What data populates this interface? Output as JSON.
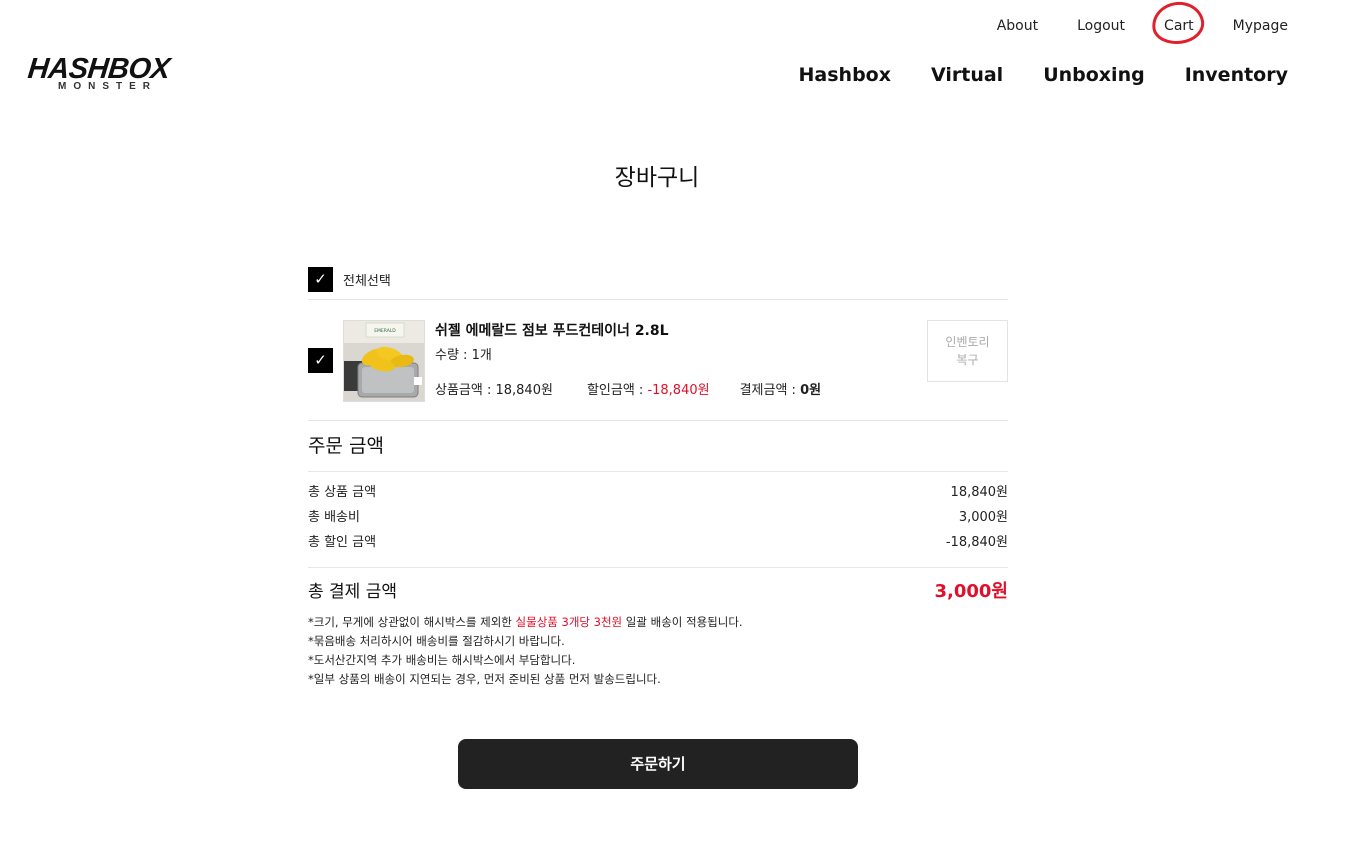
{
  "logo": {
    "main": "HASHBOX",
    "sub": "MONSTER"
  },
  "top_links": [
    "About",
    "Logout",
    "Cart",
    "Mypage"
  ],
  "main_nav": [
    "Hashbox",
    "Virtual",
    "Unboxing",
    "Inventory"
  ],
  "page_title": "장바구니",
  "select_all": {
    "checked": true,
    "label": "전체선택"
  },
  "cart_item": {
    "checked": true,
    "name": "쉬젤 에메랄드 점보 푸드컨테이너 2.8L",
    "quantity": "수량 : 1개",
    "product_price_label": "상품금액 : 18,840원",
    "discount_label": "할인금액 : ",
    "discount_value": "-18,840원",
    "payment_label": "결제금액 : ",
    "payment_value": "0원",
    "restore_button": [
      "인벤토리",
      "복구"
    ],
    "thumb_brand": "EMERALD"
  },
  "summary": {
    "title": "주문 금액",
    "rows": [
      {
        "label": "총 상품 금액",
        "value": "18,840원"
      },
      {
        "label": "총 배송비",
        "value": "3,000원"
      },
      {
        "label": "총 할인 금액",
        "value": "-18,840원"
      }
    ],
    "total_label": "총 결제 금액",
    "total_value": "3,000원"
  },
  "notes": {
    "line1_prefix": "*크기, 무게에 상관없이 해시박스를 제외한 ",
    "line1_highlight": "실물상품 3개당 3천원",
    "line1_suffix": " 일괄 배송이 적용됩니다.",
    "line2": "*묶음배송 처리하시어 배송비를 절감하시기 바랍니다.",
    "line3": "*도서산간지역 추가 배송비는 해시박스에서 부담합니다.",
    "line4": "*일부 상품의 배송이 지연되는 경우, 먼저 준비된 상품 먼저 발송드립니다."
  },
  "order_button": "주문하기",
  "colors": {
    "accent_red": "#e0102a",
    "button_dark": "#222222",
    "annotation_red": "#e0202a"
  }
}
